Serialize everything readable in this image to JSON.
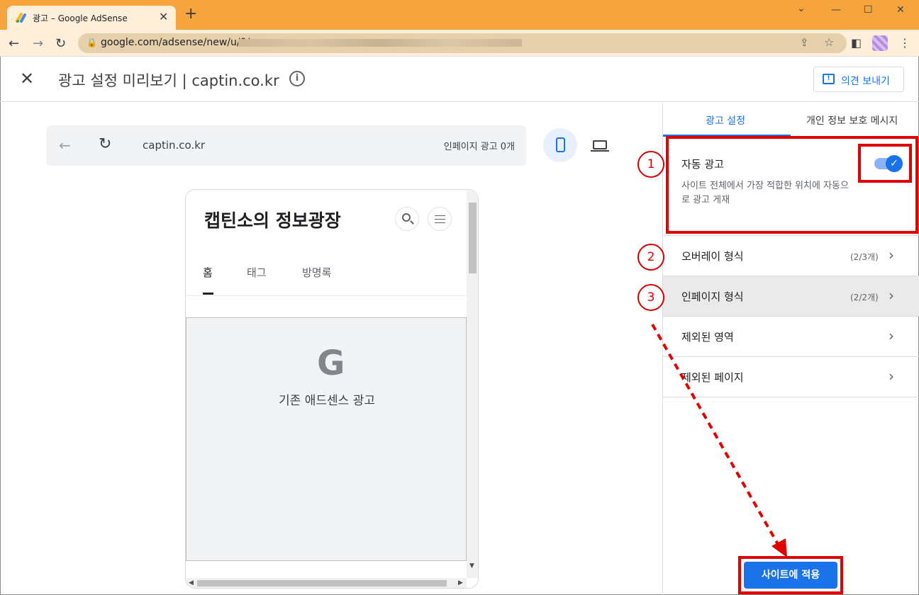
{
  "browser": {
    "tab_title": "광고 – Google AdSense",
    "tab_close": "✕",
    "new_tab": "+",
    "url": "google.com/adsense/new/u/0/",
    "window_controls": {
      "minimize": "—",
      "maximize": "☐",
      "close": "✕",
      "collapse": "⌄"
    }
  },
  "header": {
    "close": "✕",
    "title": "광고 설정 미리보기 | captin.co.kr",
    "info": "i",
    "feedback_label": "의견 보내기"
  },
  "preview": {
    "url": "captin.co.kr",
    "inpage_count": "인페이지 광고 0개",
    "blog_title": "캡틴소의 정보광장",
    "nav_tabs": [
      "홈",
      "태그",
      "방명록"
    ],
    "ad_logo": "G",
    "ad_label": "기존 애드센스 광고"
  },
  "panel": {
    "tabs": [
      "광고 설정",
      "개인 정보 보호 메시지"
    ],
    "auto_ads": {
      "title": "자동 광고",
      "description": "사이트 전체에서 가장 적합한 위치에 자동으로 광고 게재",
      "enabled": true,
      "check": "✓"
    },
    "rows": [
      {
        "label": "오버레이 형식",
        "count": "(2/3개)"
      },
      {
        "label": "인페이지 형식",
        "count": "(2/2개)"
      },
      {
        "label": "제외된 영역",
        "count": ""
      },
      {
        "label": "제외된 페이지",
        "count": ""
      }
    ],
    "apply_label": "사이트에 적용"
  },
  "annotations": [
    "1",
    "2",
    "3"
  ],
  "colors": {
    "accent": "#1a73e8",
    "annotation_red": "#e00000",
    "chrome_title": "#f6a43d"
  },
  "icons": [
    "back-icon",
    "forward-icon",
    "reload-icon",
    "lock-icon",
    "share-icon",
    "star-icon",
    "sidepanel-icon",
    "kebab-icon",
    "info-icon",
    "feedback-icon",
    "mobile-icon",
    "desktop-icon",
    "search-icon",
    "menu-icon",
    "chevron-right-icon"
  ]
}
